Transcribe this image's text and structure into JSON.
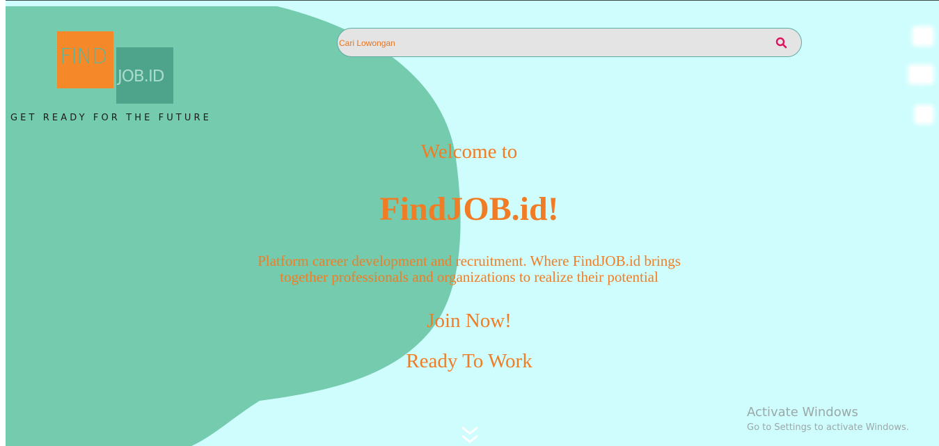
{
  "logo": {
    "find": "FIND",
    "job": "JOB.ID",
    "tagline": "GET READY FOR THE FUTURE"
  },
  "search": {
    "placeholder": "Cari Lowongan",
    "value": "",
    "button_icon": "search-icon"
  },
  "side_icons": [
    "social-icon",
    "social-icon",
    "social-icon"
  ],
  "hero": {
    "welcome": "Welcome to",
    "brand": "FindJOB.id!",
    "description": "Platform career development and recruitment. Where FindJOB.id brings together professionals and organizations to realize their potential",
    "join": "Join Now!",
    "ready": "Ready To Work",
    "scroll_icon": "chevron-double-down-icon"
  },
  "watermark": {
    "title": "Activate Windows",
    "subtitle": "Go to Settings to activate Windows."
  },
  "colors": {
    "background": "#cffdfd",
    "blob": "#74cbad",
    "accent": "#f07d25",
    "search_icon": "#e0115f"
  }
}
